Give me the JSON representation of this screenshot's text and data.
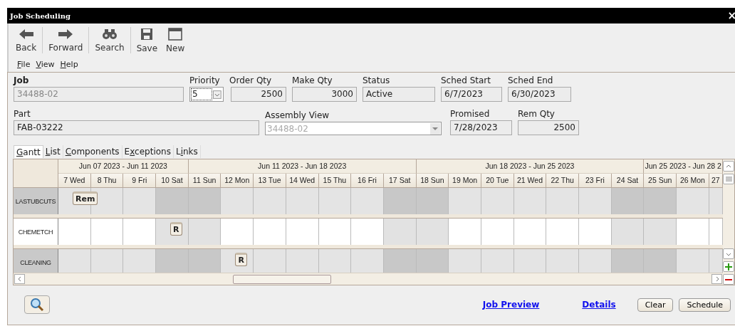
{
  "window": {
    "title": "Job Scheduling",
    "close": "×"
  },
  "toolbar": [
    {
      "kind": "back",
      "label": "Back"
    },
    {
      "kind": "forward",
      "label": "Forward"
    },
    {
      "kind": "search",
      "label": "Search"
    },
    {
      "kind": "save",
      "label": "Save"
    },
    {
      "kind": "new",
      "label": "New"
    }
  ],
  "menu": [
    {
      "key": "F",
      "rest": "ile"
    },
    {
      "key": "V",
      "rest": "iew"
    },
    {
      "key": "H",
      "rest": "elp"
    }
  ],
  "form": {
    "job": {
      "label": "Job",
      "value": "34488-02"
    },
    "priority": {
      "label": "Priority",
      "value": "5"
    },
    "order_qty": {
      "label": "Order Qty",
      "value": "2500"
    },
    "make_qty": {
      "label": "Make Qty",
      "value": "3000"
    },
    "status": {
      "label": "Status",
      "value": "Active"
    },
    "sched_start": {
      "label": "Sched Start",
      "value": "6/7/2023"
    },
    "sched_end": {
      "label": "Sched End",
      "value": "6/30/2023"
    },
    "part": {
      "label": "Part",
      "value": "FAB-03222"
    },
    "assembly_view": {
      "label": "Assembly View",
      "value": "34488-02"
    },
    "promised": {
      "label": "Promised",
      "value": "7/28/2023"
    },
    "rem_qty": {
      "label": "Rem Qty",
      "value": "2500"
    }
  },
  "tabs": [
    {
      "key": "G",
      "rest": "antt",
      "selected": true
    },
    {
      "key": "L",
      "rest": "ist",
      "selected": false
    },
    {
      "key": "C",
      "rest": "omponents",
      "selected": false
    },
    {
      "pre": "E",
      "key": "x",
      "rest": "ceptions",
      "selected": false
    },
    {
      "pre": "L",
      "key": "i",
      "rest": "nks",
      "selected": false
    }
  ],
  "gantt": {
    "weeks": [
      {
        "label": "Jun 07 2023 - Jun 11 2023",
        "days": [
          "7 Wed",
          "8 Thu",
          "9 Fri",
          "10 Sat"
        ]
      },
      {
        "label": "Jun 11 2023 - Jun 18 2023",
        "days": [
          "11 Sun",
          "12 Mon",
          "13 Tue",
          "14 Wed",
          "15 Thu",
          "16 Fri",
          "17 Sat"
        ]
      },
      {
        "label": "Jun 18 2023 - Jun 25 2023",
        "days": [
          "18 Sun",
          "19 Mon",
          "20 Tue",
          "21 Wed",
          "22 Thu",
          "23 Fri",
          "24 Sat"
        ]
      },
      {
        "label": "Jun 25 2023 - Jun 28 2",
        "days": [
          "25 Sun",
          "26 Mon",
          "27"
        ]
      }
    ],
    "rows": [
      {
        "name": "LASTUBCUTS",
        "kind": "shaded",
        "cells": [
          {
            "weekend": false,
            "bar": "Rem"
          },
          {
            "weekend": false
          },
          {
            "weekend": false
          },
          {
            "weekend": true
          },
          {
            "weekend": true
          },
          {
            "weekend": false
          },
          {
            "weekend": false
          },
          {
            "weekend": false
          },
          {
            "weekend": false
          },
          {
            "weekend": false
          },
          {
            "weekend": true
          },
          {
            "weekend": true
          },
          {
            "weekend": false
          },
          {
            "weekend": false
          },
          {
            "weekend": false
          },
          {
            "weekend": false
          },
          {
            "weekend": false
          },
          {
            "weekend": true
          },
          {
            "weekend": true
          },
          {
            "weekend": false
          },
          {
            "weekend": false
          }
        ]
      },
      {
        "name": "CHEMETCH",
        "kind": "plain",
        "cells": [
          {
            "weekend": false
          },
          {
            "weekend": false
          },
          {
            "weekend": false
          },
          {
            "weekend": true,
            "bar": "R"
          },
          {
            "weekend": true
          },
          {
            "weekend": false
          },
          {
            "weekend": false
          },
          {
            "weekend": false
          },
          {
            "weekend": false
          },
          {
            "weekend": false
          },
          {
            "weekend": true
          },
          {
            "weekend": true
          },
          {
            "weekend": false
          },
          {
            "weekend": false
          },
          {
            "weekend": false
          },
          {
            "weekend": false
          },
          {
            "weekend": false
          },
          {
            "weekend": true
          },
          {
            "weekend": true
          },
          {
            "weekend": false
          },
          {
            "weekend": false
          }
        ]
      },
      {
        "name": "CLEANING",
        "kind": "shaded",
        "cells": [
          {
            "weekend": false
          },
          {
            "weekend": false
          },
          {
            "weekend": false
          },
          {
            "weekend": true
          },
          {
            "weekend": true
          },
          {
            "weekend": false,
            "bar": "R"
          },
          {
            "weekend": false
          },
          {
            "weekend": false
          },
          {
            "weekend": false
          },
          {
            "weekend": false
          },
          {
            "weekend": true
          },
          {
            "weekend": true
          },
          {
            "weekend": false
          },
          {
            "weekend": false
          },
          {
            "weekend": false
          },
          {
            "weekend": false
          },
          {
            "weekend": false
          },
          {
            "weekend": true
          },
          {
            "weekend": true
          },
          {
            "weekend": false
          },
          {
            "weekend": false
          }
        ]
      }
    ]
  },
  "footer": {
    "links": [
      "Job Preview",
      "Details"
    ],
    "buttons": [
      "Clear",
      "Schedule"
    ]
  }
}
